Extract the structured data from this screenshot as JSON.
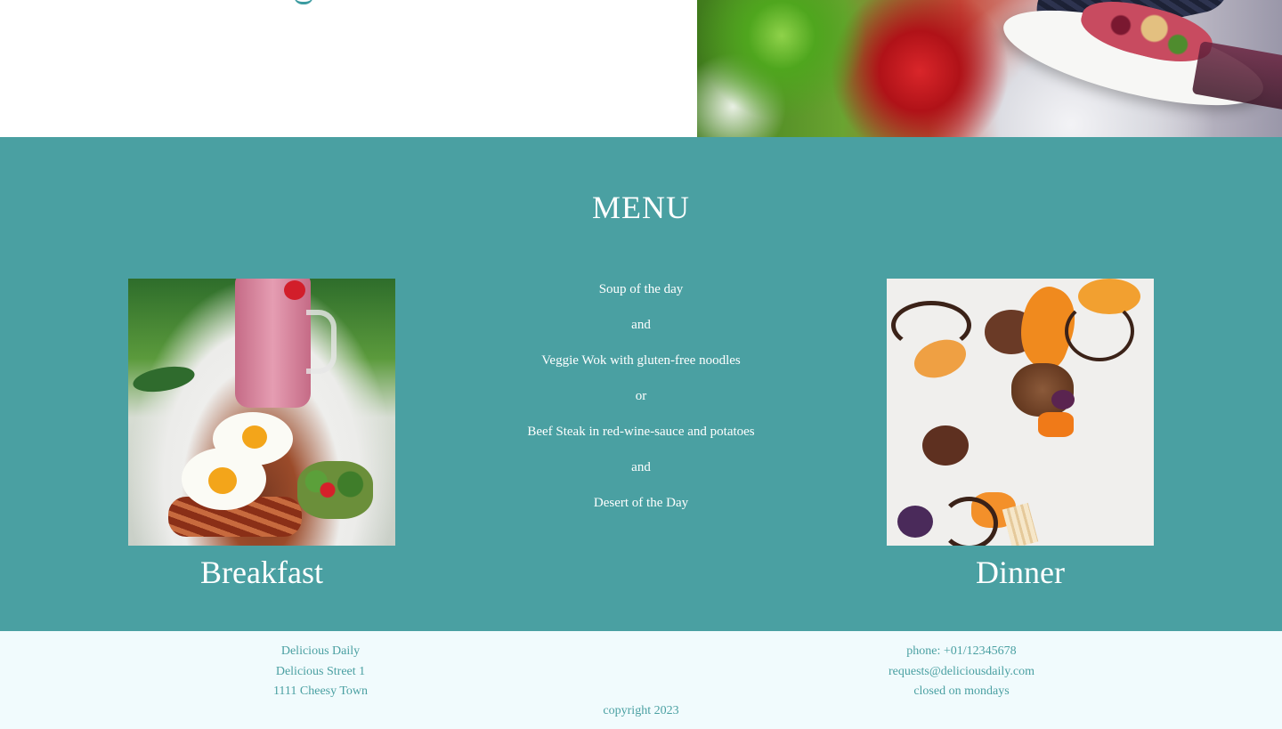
{
  "menu": {
    "title": "MENU",
    "items": [
      "Soup of the day",
      "and",
      "Veggie Wok with gluten-free noodles",
      "or",
      "Beef Steak in red-wine-sauce and potatoes",
      "and",
      "Desert of the Day"
    ],
    "breakfast_label": "Breakfast",
    "dinner_label": "Dinner"
  },
  "footer": {
    "name": "Delicious Daily",
    "street": "Delicious Street 1",
    "town": "1111 Cheesy Town",
    "phone": "phone: +01/12345678",
    "email": "requests@deliciousdaily.com",
    "hours": "closed on mondays",
    "copyright": "copyright 2023"
  },
  "colors": {
    "teal": "#4aa0a2",
    "footer_bg": "#f1fbfd",
    "white": "#ffffff"
  }
}
